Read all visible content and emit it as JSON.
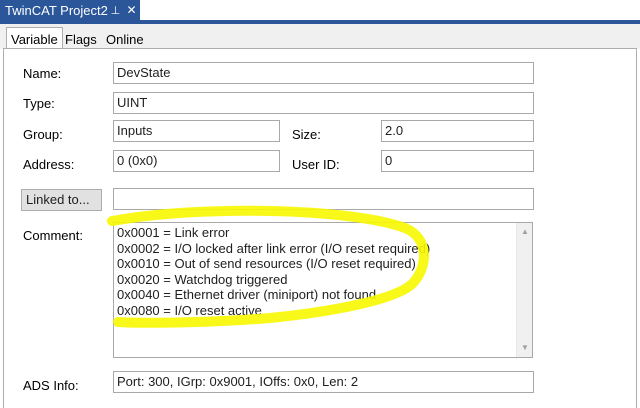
{
  "document_tab": {
    "title": "TwinCAT Project2",
    "pin_glyph": "⊥",
    "close_glyph": "✕"
  },
  "tabs": [
    {
      "label": "Variable",
      "active": true
    },
    {
      "label": "Flags",
      "active": false
    },
    {
      "label": "Online",
      "active": false
    }
  ],
  "form": {
    "name_label": "Name:",
    "name_value": "DevState",
    "type_label": "Type:",
    "type_value": "UINT",
    "group_label": "Group:",
    "group_value": "Inputs",
    "size_label": "Size:",
    "size_value": "2.0",
    "address_label": "Address:",
    "address_value": "0 (0x0)",
    "userid_label": "User ID:",
    "userid_value": "0",
    "linked_button": "Linked to...",
    "linked_value": "",
    "comment_label": "Comment:",
    "comment_lines": [
      "0x0001 = Link error",
      "0x0002 = I/O locked after link error (I/O reset required)",
      "0x0010 = Out of send resources (I/O reset required)",
      "0x0020 = Watchdog triggered",
      "0x0040 = Ethernet driver (miniport) not found",
      "0x0080 = I/O reset active"
    ],
    "ads_label": "ADS Info:",
    "ads_value": "Port: 300, IGrp: 0x9001, IOffs: 0x0, Len: 2"
  },
  "colors": {
    "accent": "#2b579a",
    "highlight": "#f7f700"
  }
}
